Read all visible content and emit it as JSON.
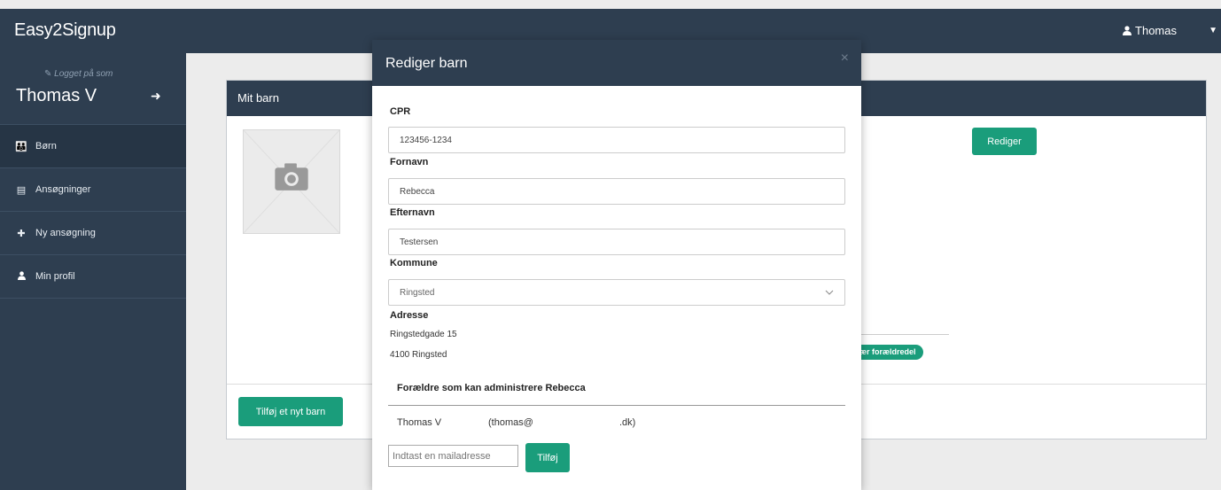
{
  "app": {
    "brand": "Easy2Signup",
    "user_menu_label": "Thomas"
  },
  "sidebar": {
    "logged_in_as": "Logget på som",
    "user_name": "Thomas V",
    "items": [
      {
        "label": "Børn",
        "icon": "children-icon"
      },
      {
        "label": "Ansøgninger",
        "icon": "list-icon"
      },
      {
        "label": "Ny ansøgning",
        "icon": "plus-icon"
      },
      {
        "label": "Min profil",
        "icon": "user-icon"
      }
    ]
  },
  "card": {
    "title": "Mit barn",
    "edit_button": "Rediger",
    "parent_pill": "ær forældredel",
    "add_child_button": "Tilføj et nyt barn"
  },
  "modal": {
    "title": "Rediger barn",
    "close": "×",
    "cpr_label": "CPR",
    "cpr_value": "123456-1234",
    "fornavn_label": "Fornavn",
    "fornavn_value": "Rebecca",
    "efternavn_label": "Efternavn",
    "efternavn_value": "Testersen",
    "kommune_label": "Kommune",
    "kommune_value": "Ringsted",
    "adresse_label": "Adresse",
    "adresse_line1": "Ringstedgade 15",
    "adresse_line2": "4100 Ringsted",
    "parents_heading": "Forældre som kan administrere Rebecca",
    "parents": [
      {
        "name": "Thomas V",
        "email_start": "(thomas@",
        "email_end": ".dk)"
      }
    ],
    "email_placeholder": "Indtast en mailadresse",
    "add_parent_button": "Tilføj"
  },
  "colors": {
    "navy": "#2e3e50",
    "accent": "#1a9d7b",
    "background": "#ececec"
  }
}
